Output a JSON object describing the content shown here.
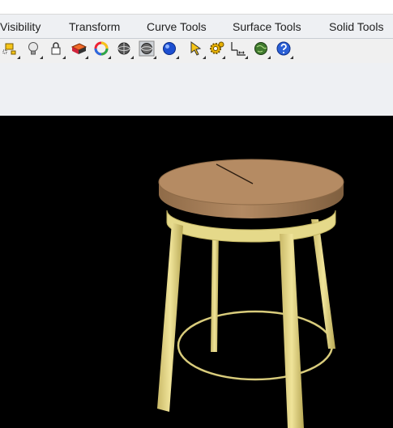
{
  "tabs": [
    {
      "label": "Visibility"
    },
    {
      "label": "Transform"
    },
    {
      "label": "Curve Tools"
    },
    {
      "label": "Surface Tools"
    },
    {
      "label": "Solid Tools"
    }
  ],
  "toolbar": {
    "icons": [
      "show-objects-icon",
      "lightbulb-icon",
      "lock-icon",
      "layer-swatch-icon",
      "color-wheel-icon",
      "shaded-sphere-icon",
      "render-sphere-icon",
      "blue-sphere-icon",
      "snap-arrow-icon",
      "settings-gear-icon",
      "dimension-icon",
      "globe-icon",
      "help-icon"
    ]
  },
  "viewport": {
    "background": "#000000",
    "model": "stool",
    "seat_color": "#b38a63",
    "frame_color": "#e5d98a"
  }
}
